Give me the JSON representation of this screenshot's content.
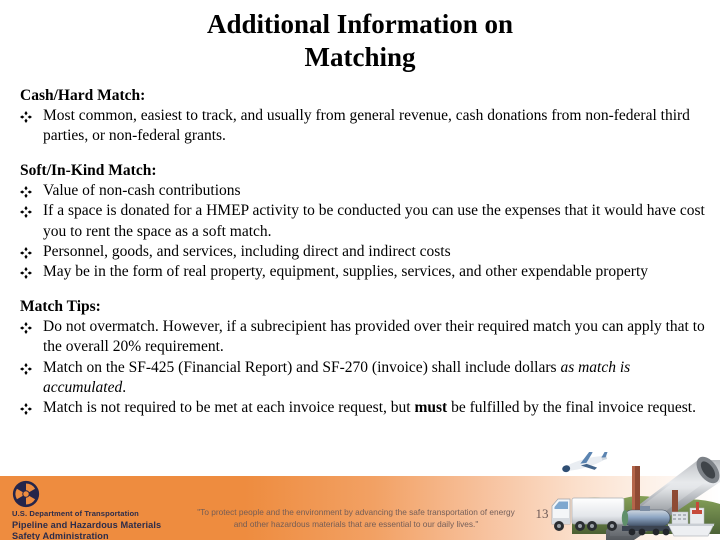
{
  "slide": {
    "title_line1": "Additional Information on",
    "title_line2": "Matching",
    "page_number": "13",
    "background_color": "#ffffff",
    "accent_color": "#ee8c3f",
    "text_color": "#000000"
  },
  "sections": [
    {
      "heading": "Cash/Hard Match:",
      "bullets": [
        "Most common, easiest to track, and usually from general revenue, cash donations from non-federal third parties, or non-federal grants."
      ]
    },
    {
      "heading": "Soft/In-Kind Match:",
      "bullets": [
        "Value of non-cash contributions",
        "If a space is donated for a HMEP activity to be conducted you can use the expenses that it would have cost you to rent the space as a soft match.",
        "Personnel, goods, and services, including direct and indirect costs",
        "May be in the form of real property, equipment, supplies, services, and other expendable property"
      ]
    },
    {
      "heading": "Match Tips:",
      "bullets": [
        "Do not overmatch. However, if a subrecipient has provided over their required match you can apply that to the overall 20% requirement.",
        "Match on the SF-425 (Financial Report) and SF-270 (invoice) shall include dollars as match is accumulated.",
        "Match is not required to be met at each invoice request, but must be fulfilled by the final invoice request."
      ],
      "bullets_rich": [
        "Do not overmatch. However, if a subrecipient has provided over their required match you can apply that to the overall 20% requirement.",
        "Match on the SF-425 (Financial Report) and SF-270 (invoice) shall include dollars <i>as match is accumulated</i>.",
        "Match is not required to be met at each invoice request, but <b>must</b> be fulfilled by the final invoice request."
      ]
    }
  ],
  "footer": {
    "agency_line": "U.S. Department of Transportation",
    "administration_line1": "Pipeline and Hazardous Materials",
    "administration_line2": "Safety Administration",
    "mission_line1": "\"To protect people and the environment by advancing the safe transportation of energy",
    "mission_line2": "and other hazardous materials that are essential to our daily lives.\"",
    "logo_name": "dot-triskelion-logo",
    "band_color_left": "#ee8c3f",
    "band_color_right": "#ffffff",
    "logo_color": "#25254a",
    "mission_text_color": "#6e5a56"
  },
  "collage": {
    "caption": "transportation modes collage",
    "items": [
      "airplane",
      "pipeline",
      "semi-truck",
      "rail-tank-car",
      "cargo-ship"
    ]
  },
  "icons": {
    "bullet": "diamond-cluster-bullet"
  }
}
